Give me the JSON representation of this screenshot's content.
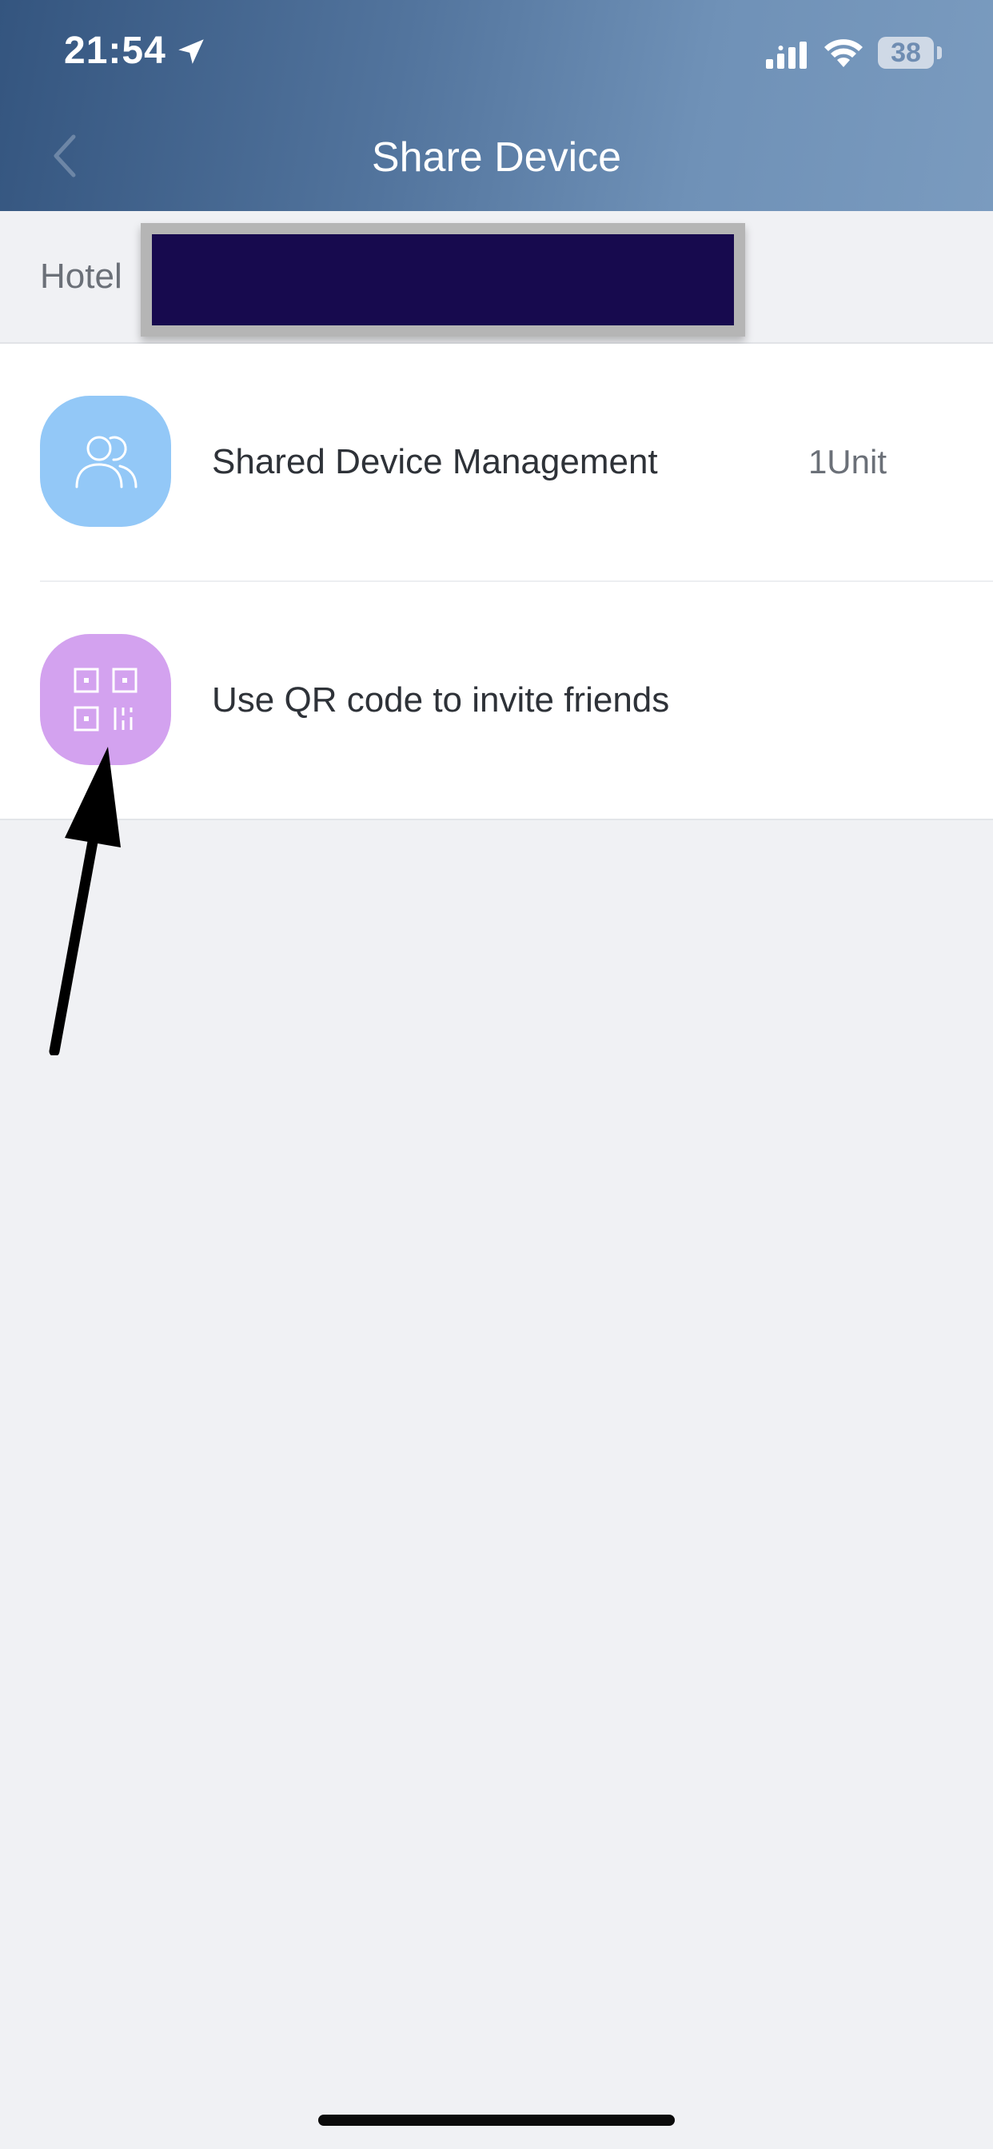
{
  "status_bar": {
    "time": "21:54",
    "battery_level": "38",
    "icons": [
      "location-arrow-icon",
      "cellular-signal-icon",
      "wifi-icon",
      "battery-icon"
    ]
  },
  "header": {
    "title": "Share Device",
    "back_icon": "chevron-left-icon",
    "gradient_colors": [
      "#34557f",
      "#7a9bbf"
    ]
  },
  "home": {
    "label": "Hotel"
  },
  "list": {
    "items": [
      {
        "label": "Shared Device Management",
        "value": "1Unit",
        "icon": "users-icon",
        "icon_color": "#93c8f7"
      },
      {
        "label": "Use QR code to invite friends",
        "icon": "qr-code-icon",
        "icon_color": "#d3a2ef"
      }
    ]
  },
  "colors": {
    "background": "#f0f1f4",
    "list_background": "#ffffff",
    "primary_text": "#2e3238",
    "secondary_text": "#6b7078",
    "redaction": "#170a4e"
  }
}
